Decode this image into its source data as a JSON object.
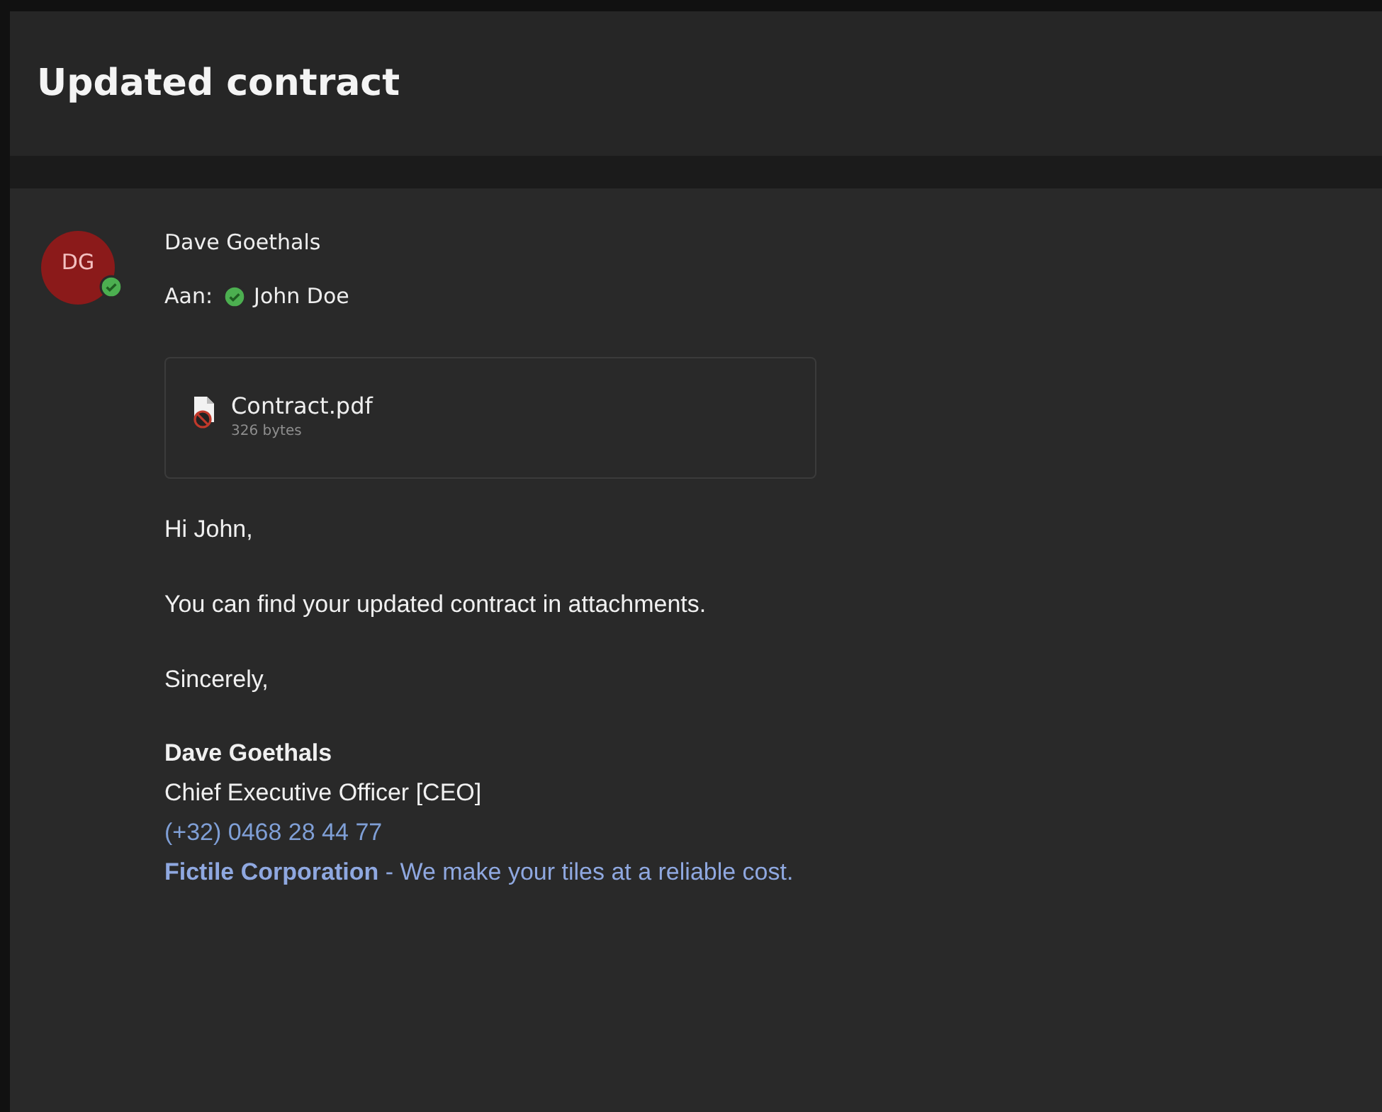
{
  "subject": "Updated contract",
  "sender": {
    "initials": "DG",
    "name": "Dave Goethals",
    "online": true
  },
  "recipients": {
    "label": "Aan:",
    "people": [
      {
        "name": "John Doe",
        "online": true
      }
    ]
  },
  "attachments": [
    {
      "name": "Contract.pdf",
      "size": "326 bytes",
      "blocked": true
    }
  ],
  "body": [
    {
      "kind": "paragraph",
      "text": "Hi John,"
    },
    {
      "kind": "paragraph",
      "text": "You can find your updated contract in attachments."
    },
    {
      "kind": "paragraph",
      "text": "Sincerely,"
    }
  ],
  "signature": [
    {
      "kind": "name",
      "text": "Dave Goethals"
    },
    {
      "kind": "title",
      "text": "Chief Executive Officer [CEO]"
    },
    {
      "kind": "phone",
      "text": "(+32) 0468 28 44 77"
    },
    {
      "kind": "company",
      "text": "**Fictile Corporation** - We make your tiles at a reliable cost."
    }
  ]
}
